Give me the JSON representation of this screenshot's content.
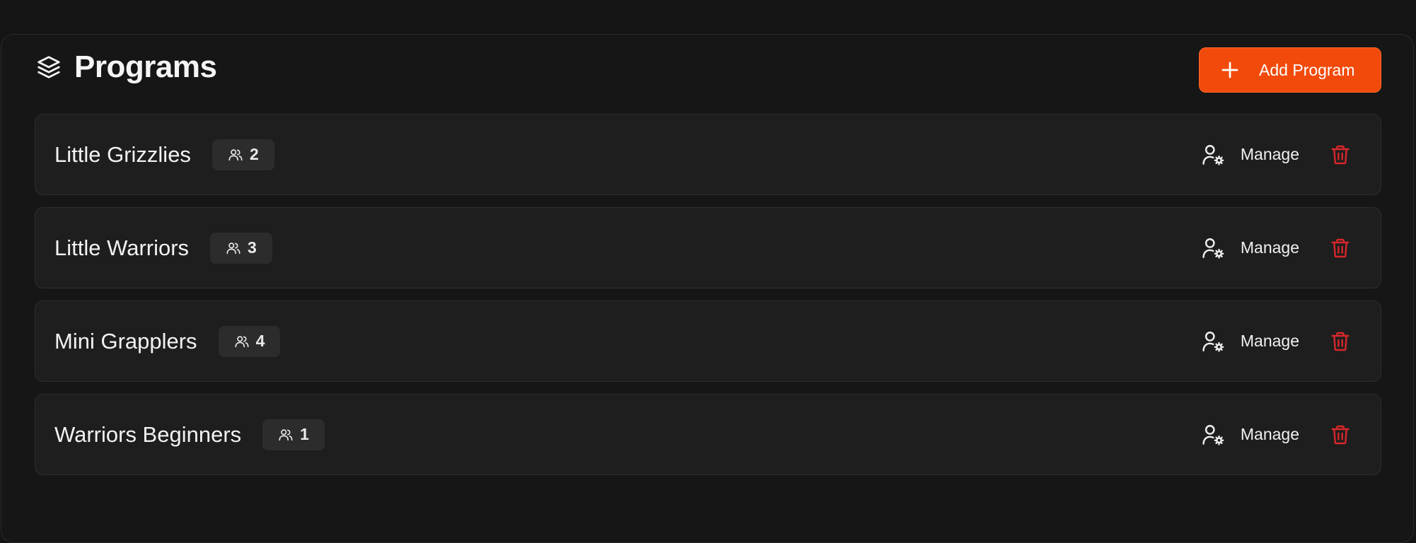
{
  "page": {
    "title": "Programs",
    "title_icon": "layers-icon",
    "add_button_label": "Add Program",
    "add_button_icon": "plus-icon"
  },
  "colors": {
    "background": "#141414",
    "panel": "#161616",
    "row": "#1e1e1e",
    "accent": "#f24a0b",
    "danger": "#d8272b"
  },
  "programs": [
    {
      "name": "Little Grizzlies",
      "member_count": "2",
      "manage_label": "Manage"
    },
    {
      "name": "Little Warriors",
      "member_count": "3",
      "manage_label": "Manage"
    },
    {
      "name": "Mini Grapplers",
      "member_count": "4",
      "manage_label": "Manage"
    },
    {
      "name": "Warriors Beginners",
      "member_count": "1",
      "manage_label": "Manage"
    }
  ]
}
